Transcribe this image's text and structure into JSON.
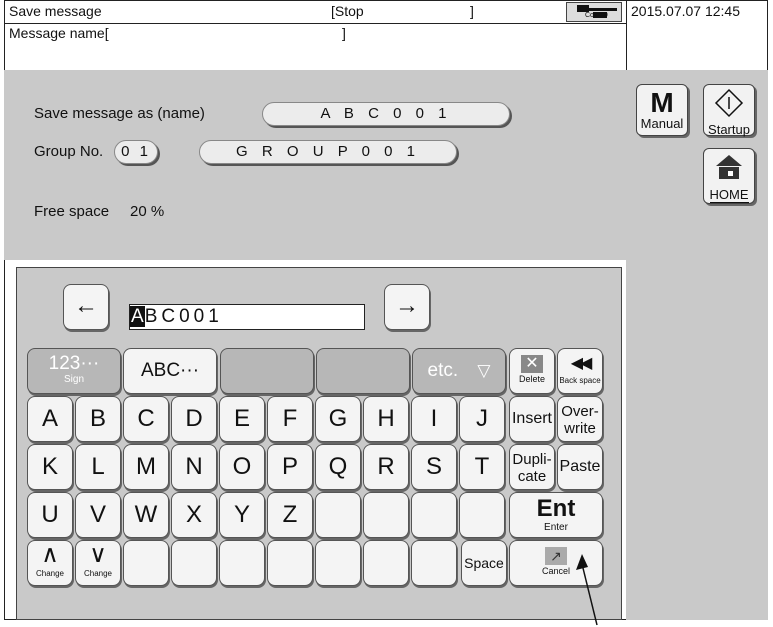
{
  "header": {
    "title": "Save message",
    "status": "[Stop",
    "status_end": "]",
    "com_label": "Com=0",
    "datetime": "2015.07.07 12:45",
    "message_name_label": "Message name[",
    "message_name_end": "]"
  },
  "form": {
    "save_as_label": "Save message as (name)",
    "save_as_value": "A B C 0 0 1",
    "group_no_label": "Group No.",
    "group_no_value": "0 1",
    "group_name_value": "G R O U P 0 0 1",
    "free_space_label": "Free space",
    "free_space_value": "20 %"
  },
  "side": {
    "manual_big": "M",
    "manual_label": "Manual",
    "startup_label": "Startup",
    "home_label": "HOME"
  },
  "keyboard": {
    "left_arrow": "←",
    "right_arrow": "→",
    "input_first": "A",
    "input_rest": "BC001",
    "mode_123": "123···",
    "mode_123_sub": "Sign",
    "mode_abc": "ABC···",
    "mode_etc": "etc.",
    "etc_arrow": "▽",
    "delete_label": "Delete",
    "backspace_label": "Back space",
    "row1": [
      "A",
      "B",
      "C",
      "D",
      "E",
      "F",
      "G",
      "H",
      "I",
      "J"
    ],
    "row2": [
      "K",
      "L",
      "M",
      "N",
      "O",
      "P",
      "Q",
      "R",
      "S",
      "T"
    ],
    "row3": [
      "U",
      "V",
      "W",
      "X",
      "Y",
      "Z"
    ],
    "insert_label": "Insert",
    "overwrite_label": "Over-\nwrite",
    "duplicate_label": "Dupli-\ncate",
    "paste_label": "Paste",
    "enter_big": "Ent",
    "enter_small": "Enter",
    "change_label": "Change",
    "space_label": "Space",
    "cancel_label": "Cancel"
  }
}
